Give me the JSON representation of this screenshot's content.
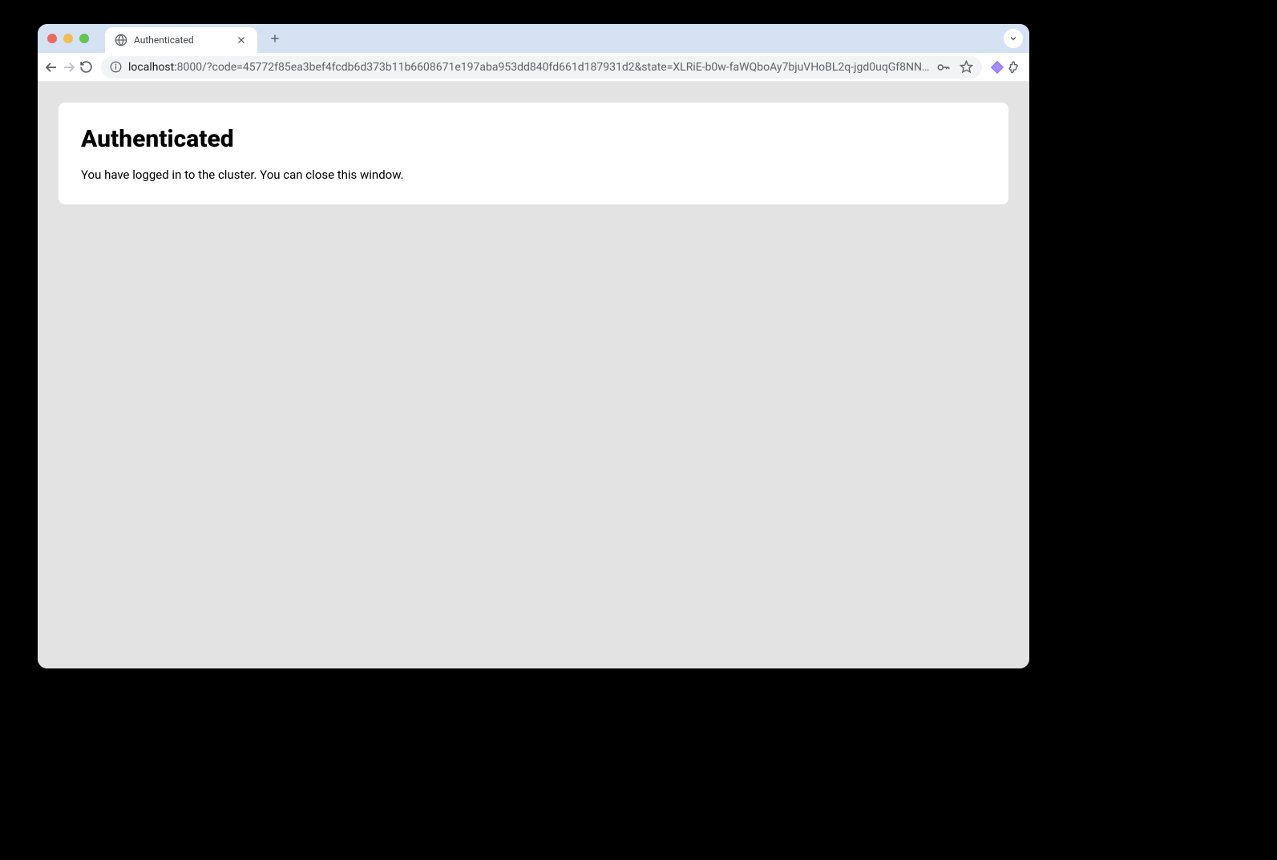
{
  "tab": {
    "title": "Authenticated"
  },
  "url": {
    "host": "localhost:",
    "rest": "8000/?code=45772f85ea3bef4fcdb6d373b11b6608671e197aba953dd840fd661d187931d2&state=XLRiE-b0w-faWQboAy7bjuVHoBL2q-jgd0uqGf8NN…"
  },
  "page": {
    "heading": "Authenticated",
    "body": "You have logged in to the cluster. You can close this window."
  }
}
